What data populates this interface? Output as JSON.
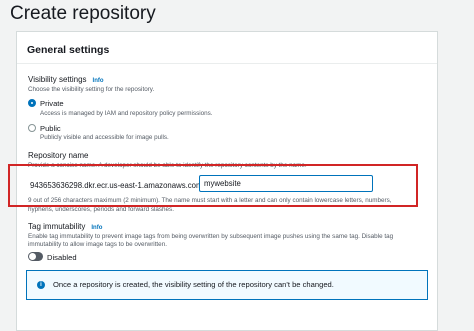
{
  "page_title": "Create repository",
  "general_settings": {
    "title": "General settings",
    "visibility": {
      "label": "Visibility settings",
      "info": "Info",
      "hint": "Choose the visibility setting for the repository.",
      "options": [
        {
          "label": "Private",
          "description": "Access is managed by IAM and repository policy permissions.",
          "selected": true
        },
        {
          "label": "Public",
          "description": "Publicly visible and accessible for image pulls.",
          "selected": false
        }
      ]
    },
    "repository_name": {
      "label": "Repository name",
      "hint": "Provide a concise name. A developer should be able to identify the repository contents by the name.",
      "prefix": "943653636298.dkr.ecr.us-east-1.amazonaws.com/",
      "value": "mywebsite",
      "constraint_line1": "9 out of 256 characters maximum (2 minimum). The name must start with a letter and can only contain lowercase letters, numbers,",
      "constraint_line2": "hyphens, underscores, periods and forward slashes."
    },
    "tag_immutability": {
      "label": "Tag immutability",
      "info": "Info",
      "hint_line1": "Enable tag immutability to prevent image tags from being overwritten by subsequent image pushes using the same tag. Disable tag",
      "hint_line2": "immutability to allow image tags to be overwritten.",
      "toggle_label": "Disabled",
      "enabled": false
    },
    "alert": {
      "text": "Once a repository is created, the visibility setting of the repository can't be changed."
    }
  },
  "colors": {
    "accent": "#0073bb",
    "highlight": "#d12525",
    "background": "#f2f3f3"
  }
}
